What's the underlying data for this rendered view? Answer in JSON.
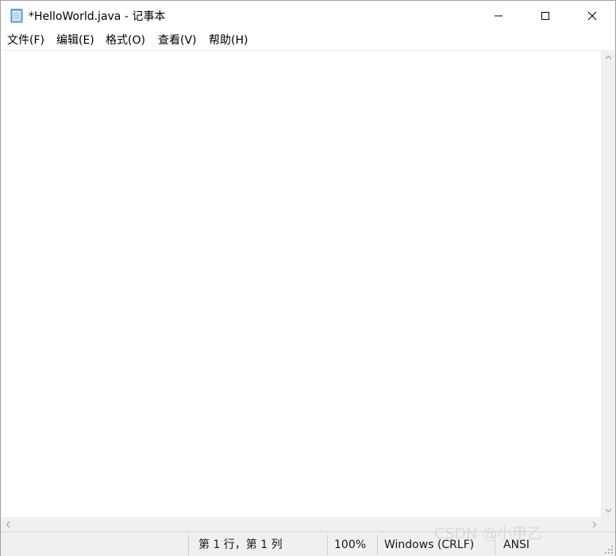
{
  "window": {
    "title": "*HelloWorld.java - 记事本"
  },
  "icons": {
    "app": "notepad-icon",
    "minimize": "minimize-icon",
    "maximize": "maximize-icon",
    "close": "close-icon"
  },
  "menu": {
    "items": [
      {
        "label": "文件(F)"
      },
      {
        "label": "编辑(E)"
      },
      {
        "label": "格式(O)"
      },
      {
        "label": "查看(V)"
      },
      {
        "label": "帮助(H)"
      }
    ]
  },
  "editor": {
    "content": ""
  },
  "status": {
    "position": "第 1 行，第 1 列",
    "zoom": "100%",
    "line_ending": "Windows (CRLF)",
    "encoding": "ANSI"
  },
  "watermark": {
    "text": "CSDN @小甲乙"
  },
  "colors": {
    "chrome": "#f0f0f0",
    "background": "#ffffff",
    "border": "#a0a0a0"
  }
}
